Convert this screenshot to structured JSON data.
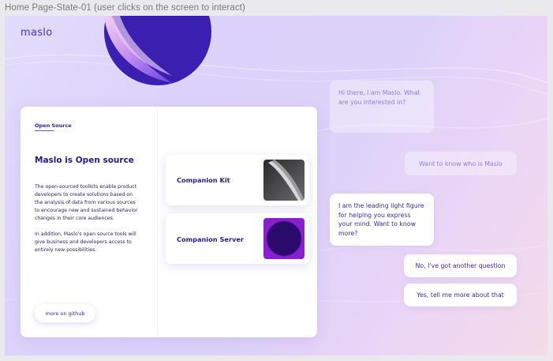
{
  "frame": {
    "label": "Home Page-State-01 (user clicks on the screen to interact)"
  },
  "header": {
    "logo": "maslo"
  },
  "card": {
    "tag": "Open Source",
    "title": "Maslo is Open source",
    "body_1": "The open-sourced toolkits enable product developers to create solutions based on the analysis of data from various sources to encourage new and sustained behavior changes in their core audiences.",
    "body_2": "In addition, Maslo's open source tools will give business and developers access to entirely new possibilities.",
    "github_button": "more on github"
  },
  "kits": [
    {
      "label": "Companion Kit",
      "thumb_icon": "curled-page-icon"
    },
    {
      "label": "Companion Server",
      "thumb_icon": "circle-orb-icon"
    }
  ],
  "chat": {
    "greeting": "Hi there, I am Maslo. What are you interested in?",
    "user_message": "Want to know who is Maslo",
    "bot_reply": "I am the leading light figure for helping you express your mind. Want to know more?",
    "option_1": "No, I've got another question",
    "option_2": "Yes, tell me more about that"
  },
  "colors": {
    "accent": "#3222a0",
    "orb": "#3a1fb0",
    "server_thumb": "#8a1fd0"
  }
}
